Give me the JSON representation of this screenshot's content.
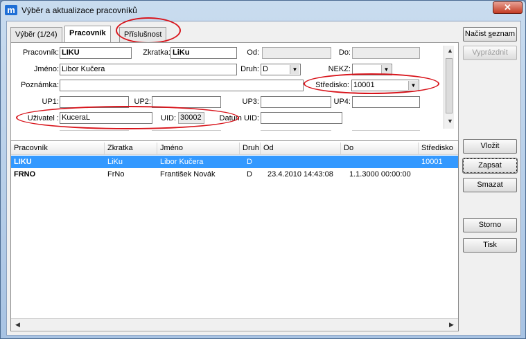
{
  "window": {
    "title": "Výběr a aktualizace pracovníků",
    "app_icon": "m",
    "close_glyph": "✕"
  },
  "tabs": [
    "Výběr (1/24)",
    "Pracovník",
    "Příslušnost"
  ],
  "form": {
    "pracovnik_label": "Pracovník:",
    "pracovnik_value": "LIKU",
    "zkratka_label": "Zkratka:",
    "zkratka_value": "LiKu",
    "od_label": "Od:",
    "od_value": "",
    "do_label": "Do:",
    "do_value": "",
    "jmeno_label": "Jméno:",
    "jmeno_value": "Libor Kučera",
    "druh_label": "Druh:",
    "druh_value": "D",
    "nekz_label": "NEKZ:",
    "nekz_value": "",
    "poznamka_label": "Poznámka:",
    "poznamka_value": "",
    "stredisko_label": "Středisko:",
    "stredisko_value": "10001",
    "up1_label": "UP1:",
    "up2_label": "UP2:",
    "up3_label": "UP3:",
    "up4_label": "UP4:",
    "uzivatel_label": "Uživatel :",
    "uzivatel_value": "KuceraL",
    "uid_label": "UID:",
    "uid_value": "30002",
    "datum_uid_label": "Datum UID:",
    "datum_uid_value": ""
  },
  "buttons": {
    "nacist_pre": "Načist ",
    "nacist_u": "s",
    "nacist_post": "eznam",
    "vyprazdnit": "Vyprázdnit",
    "vlozit": "Vložit",
    "zapsat": "Zapsat",
    "smazat": "Smazat",
    "storno": "Storno",
    "tisk": "Tisk"
  },
  "table": {
    "columns": [
      "Pracovník",
      "Zkratka",
      "Jméno",
      "Druh",
      "Od",
      "Do",
      "Středisko"
    ],
    "rows": [
      [
        "LIKU",
        "LiKu",
        "Libor Kučera",
        "D",
        "",
        "",
        "10001"
      ],
      [
        "FRNO",
        "FrNo",
        "František Novák",
        "D",
        "23.4.2010 14:43:08",
        "1.1.3000 00:00:00",
        ""
      ]
    ]
  },
  "colors": {
    "selection": "#3399ff",
    "annotation": "#d8141b",
    "close": "#c43c24"
  },
  "icons": [
    "app-icon",
    "close-icon",
    "dropdown-arrow-icon",
    "scroll-up-icon",
    "scroll-down-icon",
    "scroll-left-icon",
    "scroll-right-icon"
  ]
}
